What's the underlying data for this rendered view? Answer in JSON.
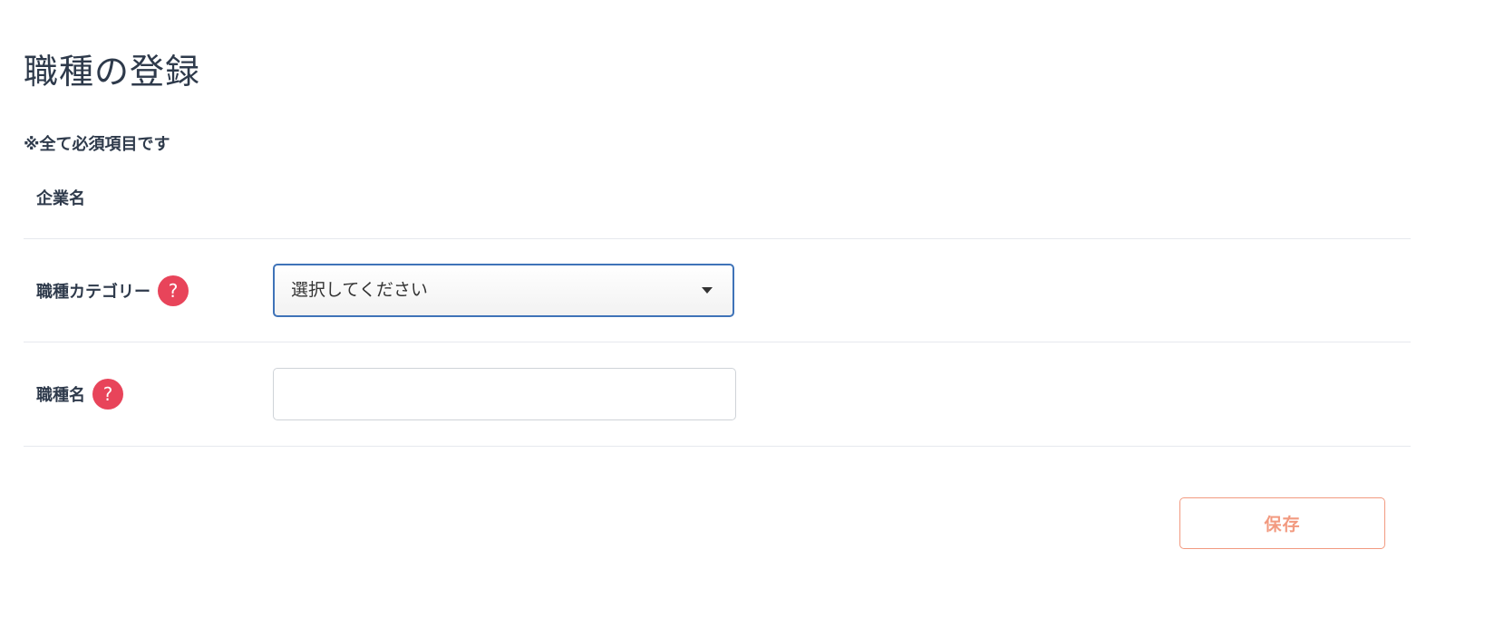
{
  "page": {
    "title": "職種の登録",
    "required_note": "※全て必須項目です"
  },
  "form": {
    "company": {
      "label": "企業名"
    },
    "category": {
      "label": "職種カテゴリー",
      "help_icon": "question-icon",
      "selected_value": "選択してください"
    },
    "job_name": {
      "label": "職種名",
      "help_icon": "question-icon",
      "value": "",
      "placeholder": ""
    }
  },
  "actions": {
    "save_label": "保存"
  },
  "icons": {
    "help_glyph": "?"
  },
  "colors": {
    "text": "#2e3a4b",
    "help_icon_bg": "#e8445a",
    "select_border": "#3f73b8",
    "save_accent": "#f29a80"
  }
}
